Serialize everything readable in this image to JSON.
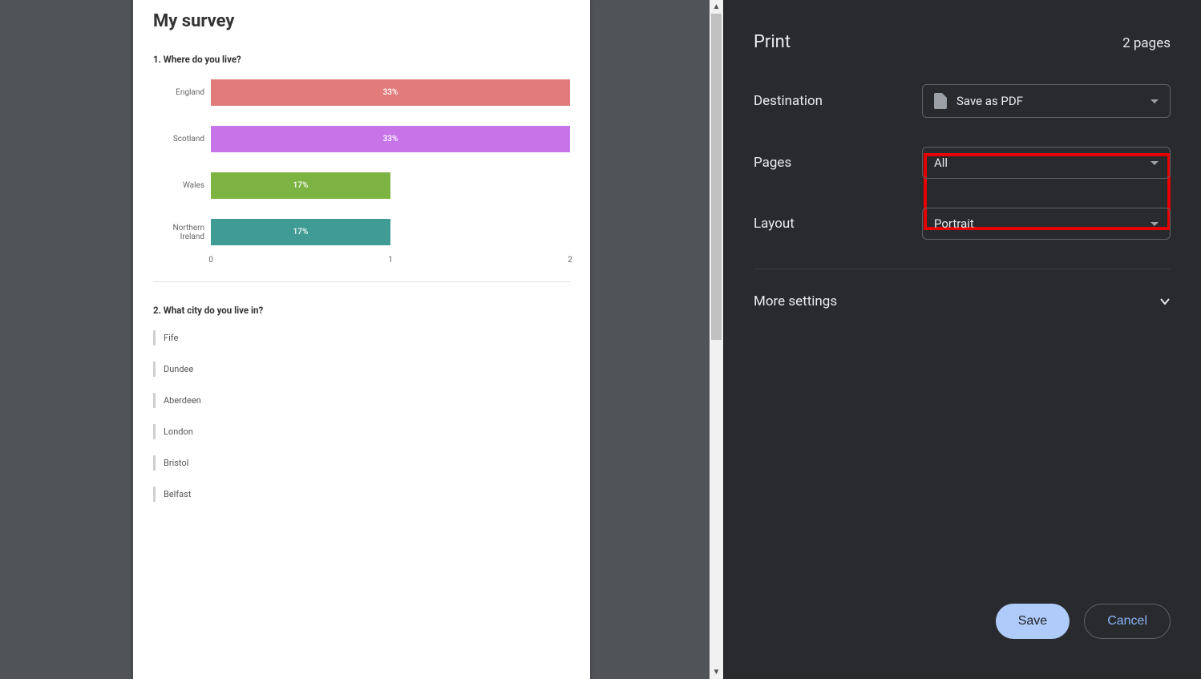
{
  "preview": {
    "title": "My survey",
    "question1": {
      "heading": "1. Where do you live?"
    },
    "question2": {
      "heading": "2. What city do you live in?",
      "answers": [
        "Fife",
        "Dundee",
        "Aberdeen",
        "London",
        "Bristol",
        "Belfast"
      ]
    }
  },
  "chart_data": {
    "type": "bar",
    "orientation": "horizontal",
    "categories": [
      "England",
      "Scotland",
      "Wales",
      "Northern Ireland"
    ],
    "values": [
      2,
      2,
      1,
      1
    ],
    "bar_labels": [
      "33%",
      "33%",
      "17%",
      "17%"
    ],
    "colors": [
      "#e27c7c",
      "#c774e8",
      "#7cb342",
      "#3f9b94"
    ],
    "xlim": [
      0,
      2
    ],
    "xticks": [
      0,
      1,
      2
    ]
  },
  "panel": {
    "title": "Print",
    "page_count": "2 pages",
    "destination_label": "Destination",
    "destination_value": "Save as PDF",
    "pages_label": "Pages",
    "pages_value": "All",
    "layout_label": "Layout",
    "layout_value": "Portrait",
    "more_label": "More settings",
    "save_label": "Save",
    "cancel_label": "Cancel"
  }
}
